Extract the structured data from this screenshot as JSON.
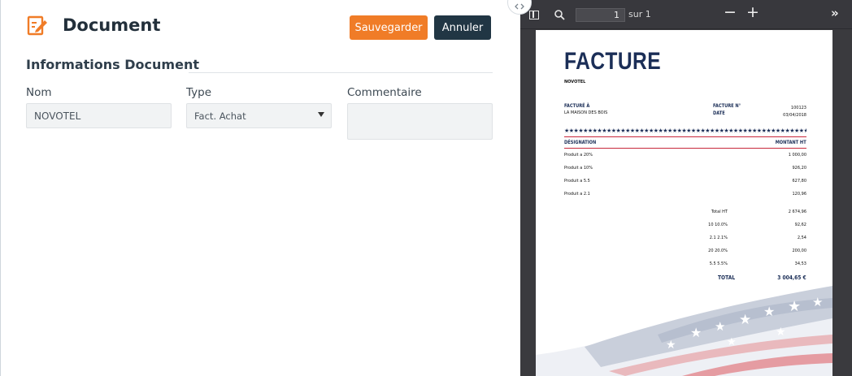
{
  "form": {
    "title": "Document",
    "icon": "edit-document-icon",
    "save_label": "Sauvegarder",
    "cancel_label": "Annuler",
    "section_title": "Informations Document",
    "fields": {
      "nom": {
        "label": "Nom",
        "value": "NOVOTEL"
      },
      "type": {
        "label": "Type",
        "value": "Fact. Achat"
      },
      "commentaire": {
        "label": "Commentaire",
        "value": ""
      }
    },
    "colors": {
      "accent": "#f07c27",
      "dark": "#213644"
    }
  },
  "pdf_viewer": {
    "page_value": "1",
    "page_of": "sur 1",
    "zoom_out": "−",
    "zoom_in": "+",
    "more": "»"
  },
  "invoice": {
    "title": "FACTURE",
    "company": "NOVOTEL",
    "billed_to_label": "FACTURÉ À",
    "billed_to_value": "LA MAISON DES BOIS",
    "invoice_no_label": "FACTURE N°",
    "invoice_no_value": "100123",
    "date_label": "DATE",
    "date_value": "03/04/2018",
    "col_designation": "DÉSIGNATION",
    "col_amount": "MONTANT HT",
    "items": [
      {
        "name": "Produit a 20%",
        "amount": "1 000,00"
      },
      {
        "name": "Produit a 10%",
        "amount": "926,20"
      },
      {
        "name": "Produit a 5.5",
        "amount": "627,80"
      },
      {
        "name": "Produit a 2.1",
        "amount": "120,96"
      }
    ],
    "totals": [
      {
        "name": "Total HT",
        "amount": "2 674,96"
      },
      {
        "name": "10 10.0%",
        "amount": "92,62"
      },
      {
        "name": "2.1 2.1%",
        "amount": "2,54"
      },
      {
        "name": "20 20.0%",
        "amount": "200,00"
      },
      {
        "name": "5.5 5.5%",
        "amount": "34,53"
      }
    ],
    "grand_total_label": "TOTAL",
    "grand_total_value": "3 004,65 €",
    "colors": {
      "navy": "#1b2e57",
      "red": "#c8283b"
    }
  }
}
